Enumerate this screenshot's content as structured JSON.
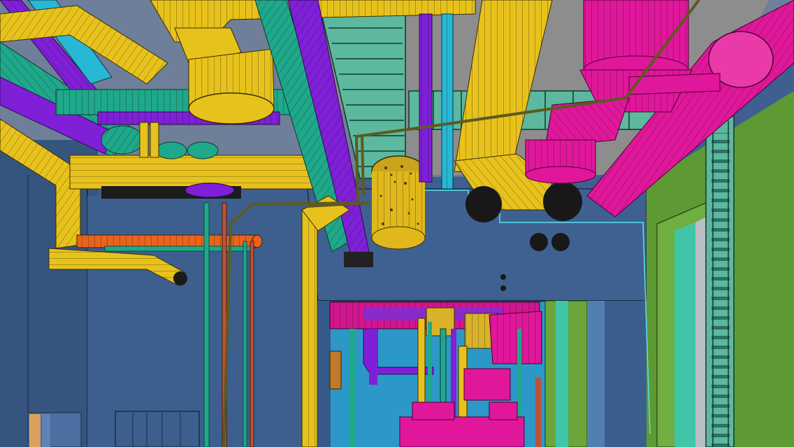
{
  "scene": {
    "kind": "3d-bim-mep-model-view",
    "colors": {
      "wall_blue": "#3e5f8f",
      "wall_dark": "#34527d",
      "ceiling_gray": "#8f8f8f",
      "duct_yellow": "#e8c21c",
      "pipe_magenta": "#e0179b",
      "pipe_green": "#1fa88a",
      "pipe_purple": "#7f1fd8",
      "pipe_cyan": "#28b7d4",
      "pipe_orange": "#e8641c",
      "tray_teal": "#5ec2a6",
      "door_green": "#6aa63a",
      "cable_olive": "#5e5a1e",
      "edge_dark": "#111111"
    }
  }
}
